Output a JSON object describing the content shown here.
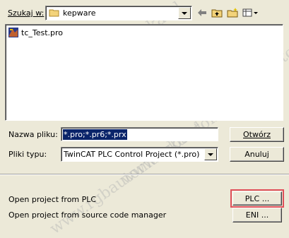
{
  "lookin": {
    "label": "Szukaj w:",
    "folder": "kepware"
  },
  "files": [
    {
      "name": "tc_Test.pro"
    }
  ],
  "filename": {
    "label": "Nazwa pliku:",
    "value": "*.pro;*.pr6;*.prx"
  },
  "filetype": {
    "label": "Pliki typu:",
    "value": "TwinCAT PLC Control Project (*.pro)"
  },
  "buttons": {
    "open": "Otwórz",
    "cancel": "Anuluj",
    "plc": "PLC ...",
    "eni": "ENI ..."
  },
  "bottom": {
    "open_from_plc": "Open project from PLC",
    "open_from_scm": "Open project from source code manager"
  },
  "watermark": "www.rgbautomatyka.pl",
  "colors": {
    "highlight": "#0a246a",
    "plc_outline": "#e0505a",
    "dialog_bg": "#ece9d8"
  }
}
